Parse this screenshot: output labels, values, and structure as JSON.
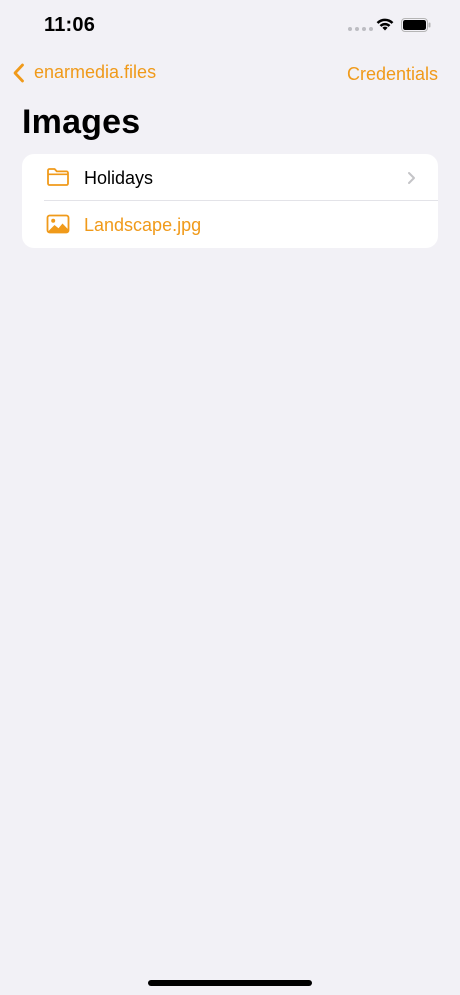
{
  "status_bar": {
    "time": "11:06"
  },
  "nav": {
    "back_label": "enarmedia.files",
    "right_button_label": "Credentials"
  },
  "page": {
    "title": "Images"
  },
  "items": [
    {
      "label": "Holidays",
      "type": "folder",
      "icon": "folder-icon"
    },
    {
      "label": "Landscape.jpg",
      "type": "file",
      "icon": "image-icon"
    }
  ],
  "colors": {
    "accent": "#f09a1a",
    "background": "#f2f1f6",
    "card": "#ffffff"
  }
}
